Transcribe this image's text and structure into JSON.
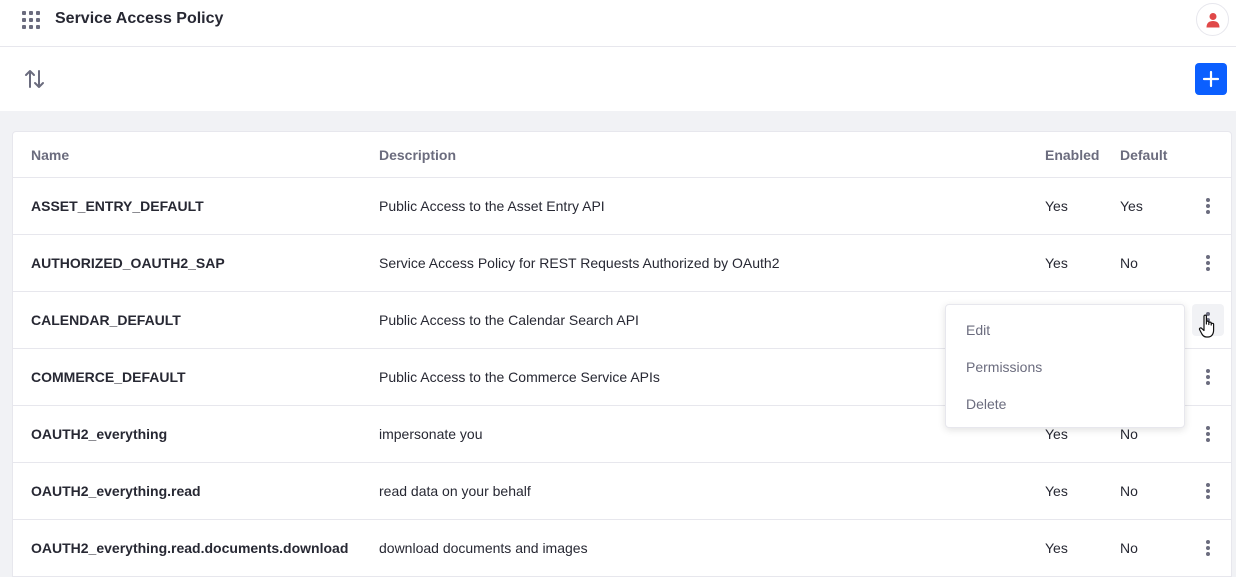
{
  "header": {
    "title": "Service Access Policy"
  },
  "table": {
    "columns": {
      "name": "Name",
      "description": "Description",
      "enabled": "Enabled",
      "default": "Default"
    },
    "rows": [
      {
        "name": "ASSET_ENTRY_DEFAULT",
        "description": "Public Access to the Asset Entry API",
        "enabled": "Yes",
        "default": "Yes"
      },
      {
        "name": "AUTHORIZED_OAUTH2_SAP",
        "description": "Service Access Policy for REST Requests Authorized by OAuth2",
        "enabled": "Yes",
        "default": "No"
      },
      {
        "name": "CALENDAR_DEFAULT",
        "description": "Public Access to the Calendar Search API",
        "enabled": "",
        "default": ""
      },
      {
        "name": "COMMERCE_DEFAULT",
        "description": "Public Access to the Commerce Service APIs",
        "enabled": "",
        "default": ""
      },
      {
        "name": "OAUTH2_everything",
        "description": "impersonate you",
        "enabled": "Yes",
        "default": "No"
      },
      {
        "name": "OAUTH2_everything.read",
        "description": "read data on your behalf",
        "enabled": "Yes",
        "default": "No"
      },
      {
        "name": "OAUTH2_everything.read.documents.download",
        "description": "download documents and images",
        "enabled": "Yes",
        "default": "No"
      }
    ]
  },
  "dropdown": {
    "items": [
      "Edit",
      "Permissions",
      "Delete"
    ]
  },
  "colors": {
    "primary": "#0b5fff",
    "avatar_icon": "#e04848",
    "secondary_text": "#6b6c7e"
  }
}
